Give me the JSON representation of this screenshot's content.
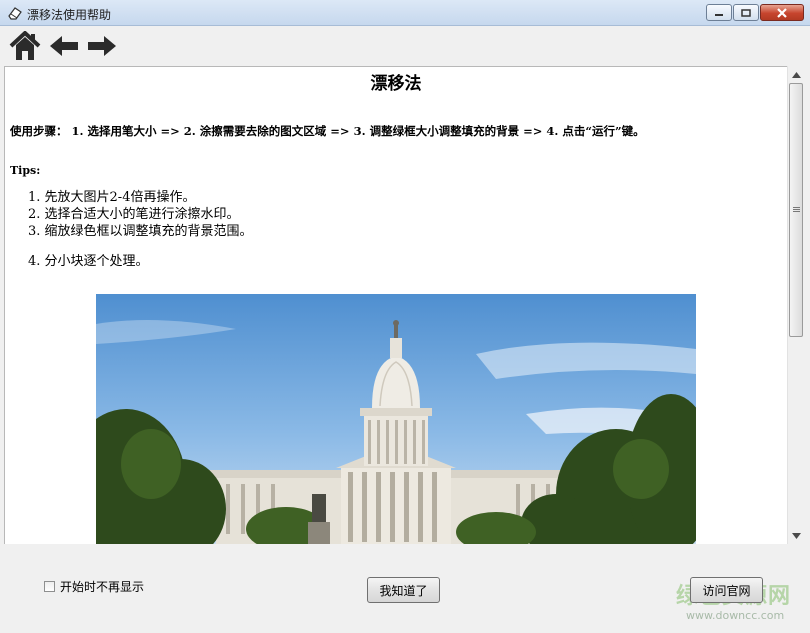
{
  "window": {
    "title": "漂移法使用帮助",
    "app_icon": "eraser-icon"
  },
  "toolbar": {
    "icons": [
      "home-icon",
      "back-arrow-icon",
      "forward-arrow-icon"
    ]
  },
  "document": {
    "title": "漂移法",
    "steps": "使用步骤： 1. 选择用笔大小 => 2. 涂擦需要去除的图文区域 => 3. 调整绿框大小调整填充的背景 => 4. 点击“运行”键。",
    "tips_label": "Tips:",
    "tips": [
      "1.  先放大图片2-4倍再操作。",
      "2.  选择合适大小的笔进行涂擦水印。",
      "3.  缩放绿色框以调整填充的背景范围。",
      "4.  分小块逐个处理。"
    ]
  },
  "footer": {
    "checkbox_label": "开始时不再显示",
    "ok_button": "我知道了",
    "visit_button": "访问官网",
    "watermark_logo": "绿色资源网",
    "watermark_url": "www.downcc.com"
  }
}
